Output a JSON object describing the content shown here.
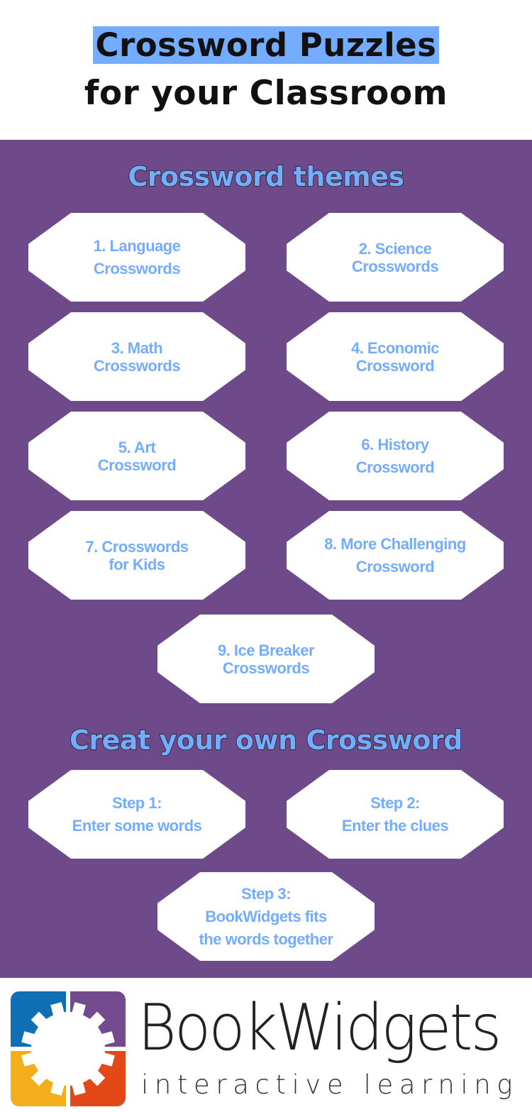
{
  "header": {
    "title_line1": "Crossword Puzzles",
    "title_line2": "for your Classroom",
    "highlight_color": "#74acff"
  },
  "panel": {
    "background_color": "#6f4a8a",
    "themes_heading": "Crossword themes",
    "themes": [
      {
        "label": "1. Language\nCrosswords"
      },
      {
        "label": "2. Science\nCrosswords"
      },
      {
        "label": "3. Math\nCrosswords"
      },
      {
        "label": "4. Economic\nCrossword"
      },
      {
        "label": "5. Art\nCrossword"
      },
      {
        "label": "6. History\nCrossword"
      },
      {
        "label": "7. Crosswords\nfor Kids"
      },
      {
        "label": "8. More Challenging\nCrossword"
      },
      {
        "label": "9. Ice Breaker\nCrosswords"
      }
    ],
    "create_heading": "Creat your own Crossword",
    "steps": [
      {
        "label": "Step 1:\nEnter some words"
      },
      {
        "label": "Step 2:\nEnter the clues"
      },
      {
        "label": "Step 3:\nBookWidgets fits\nthe words together"
      }
    ]
  },
  "footer": {
    "brand_name": "BookWidgets",
    "tagline": "interactive learning",
    "logo_icon": "gear-puzzle-logo",
    "logo_colors": {
      "top_left": "#0f6fb5",
      "top_right": "#744a8e",
      "bottom_left": "#f5ae1b",
      "bottom_right": "#e34817"
    }
  }
}
